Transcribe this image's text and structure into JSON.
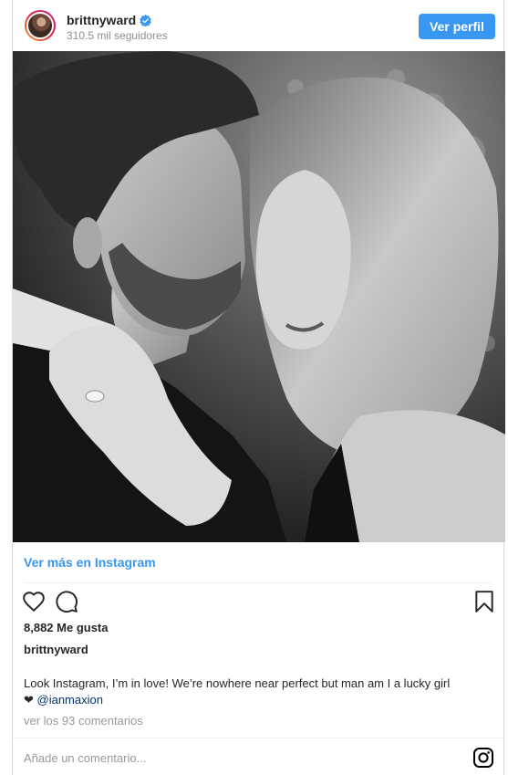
{
  "header": {
    "username": "brittnyward",
    "followers": "310.5 mil seguidores",
    "view_profile_label": "Ver perfil"
  },
  "post": {
    "more_link": "Ver más en Instagram",
    "likes": "8,882 Me gusta",
    "caption_user": "brittnyward",
    "caption_text": "Look Instagram, I’m in love! We’re nowhere near perfect but man am I a lucky girl",
    "caption_emoji": "❤ ",
    "caption_mention": "@ianmaxion",
    "comments_link": "ver los 93 comentarios"
  },
  "comment_box": {
    "placeholder": "Añade un comentario..."
  },
  "icons": [
    "verified-icon",
    "heart-icon",
    "comment-icon",
    "bookmark-icon",
    "instagram-icon"
  ],
  "colors": {
    "accent": "#3897f0",
    "mention": "#003569",
    "muted": "#8e8e8e"
  }
}
